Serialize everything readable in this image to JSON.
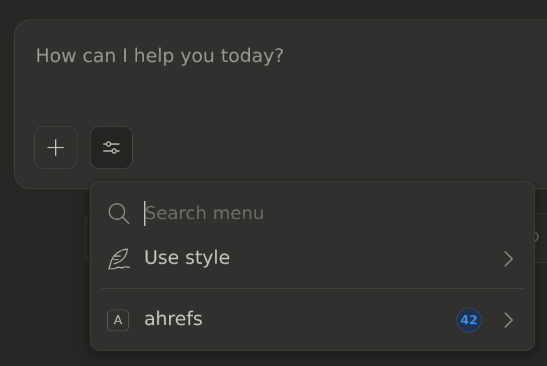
{
  "composer": {
    "placeholder": "How can I help you today?"
  },
  "toolbar": {
    "add_icon": "plus-icon",
    "tools_icon": "sliders-icon"
  },
  "menu": {
    "search_placeholder": "Search menu",
    "items": [
      {
        "label": "Use style",
        "icon": "feather-icon"
      },
      {
        "label": "ahrefs",
        "icon_letter": "A",
        "count": "42",
        "count_color": "#3d8eea"
      }
    ]
  },
  "colors": {
    "background": "#262624",
    "surface": "#30302e",
    "border": "#454540",
    "accent": "#3d8eea"
  }
}
